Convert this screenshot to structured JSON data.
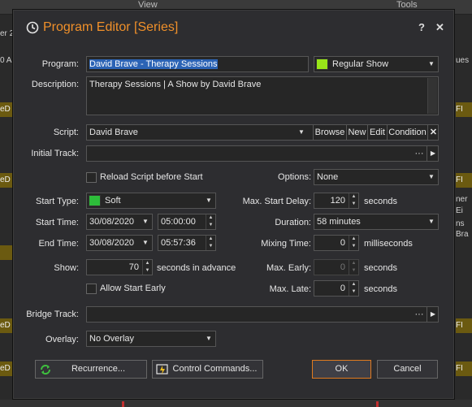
{
  "background": {
    "tab_view": "View",
    "tab_tools": "Tools",
    "left_text_1": "er 2",
    "left_text_2": "0 A",
    "chip_left": "eD",
    "chip_right": "FI",
    "right_text_1": "ues",
    "right_text_2": "ner",
    "right_text_3": "Ei",
    "right_text_4": "ns",
    "right_text_5": "Bra"
  },
  "dialog": {
    "title": "Program Editor [Series]",
    "help": "?",
    "close": "✕"
  },
  "form": {
    "program_label": "Program:",
    "program_value": "David Brave - Therapy Sessions",
    "show_type_value": "Regular Show",
    "show_type_color": "#99e619",
    "description_label": "Description:",
    "description_value": "Therapy Sessions | A Show by David Brave",
    "script_label": "Script:",
    "script_value": "David Brave",
    "script_browse": "Browse",
    "script_new": "New",
    "script_edit": "Edit",
    "script_condition": "Condition",
    "script_clear": "✕",
    "initial_track_label": "Initial Track:",
    "initial_track_value": "",
    "ellipsis": "···",
    "play": "▶",
    "reload_label": "Reload Script before Start",
    "options_label": "Options:",
    "options_value": "None",
    "start_type_label": "Start Type:",
    "start_type_value": "Soft",
    "start_type_color": "#2dbd3a",
    "max_start_delay_label": "Max. Start Delay:",
    "max_start_delay_value": "120",
    "seconds": "seconds",
    "start_time_label": "Start Time:",
    "start_date": "30/08/2020",
    "start_time": "05:00:00",
    "duration_label": "Duration:",
    "duration_value": "58 minutes",
    "end_time_label": "End Time:",
    "end_date": "30/08/2020",
    "end_time": "05:57:36",
    "mixing_time_label": "Mixing Time:",
    "mixing_time_value": "0",
    "milliseconds": "milliseconds",
    "show_label": "Show:",
    "show_value": "70",
    "seconds_in_advance": "seconds in advance",
    "max_early_label": "Max. Early:",
    "max_early_value": "0",
    "allow_start_early_label": "Allow Start Early",
    "max_late_label": "Max. Late:",
    "max_late_value": "0",
    "bridge_track_label": "Bridge Track:",
    "bridge_track_value": "",
    "overlay_label": "Overlay:",
    "overlay_value": "No Overlay"
  },
  "buttons": {
    "recurrence": "Recurrence...",
    "control_commands": "Control Commands...",
    "ok": "OK",
    "cancel": "Cancel"
  }
}
